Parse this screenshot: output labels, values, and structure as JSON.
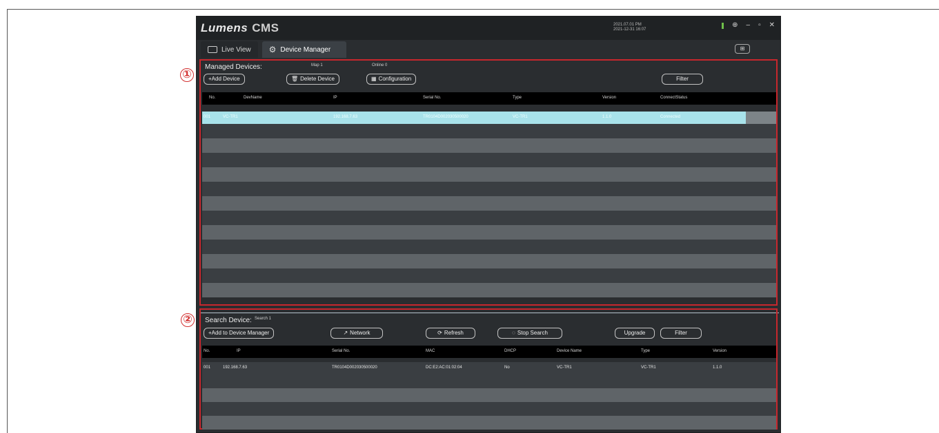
{
  "app": {
    "logo": "Lumens",
    "product": "CMS",
    "datetime_line1": "2021.07.01 PM",
    "datetime_line2": "2021-12-31 16:07",
    "ctrl_minimize": "–",
    "ctrl_maximize": "▫",
    "ctrl_close": "✕",
    "ctrl_pin": "⊕"
  },
  "tabs": [
    {
      "label": "Live View",
      "icon": "live-view-icon"
    },
    {
      "label": "Device Manager",
      "icon": "gear-icon"
    }
  ],
  "lock_label": "⊞",
  "markers": [
    "①",
    "②"
  ],
  "managed": {
    "title": "Managed Devices:",
    "stat_total": "Map 1",
    "stat_online": "Online 0",
    "buttons": {
      "add": "+Add Device",
      "delete": "Delete Device",
      "config": "Configuration",
      "filter": "Filter"
    },
    "columns": [
      "No.",
      "DevName",
      "IP",
      "Serial No.",
      "Type",
      "Version",
      "ConnectStatus"
    ],
    "rows": [
      [
        "001",
        "VC-TR1",
        "192.168.7.63",
        "TR0104D002030500020",
        "VC-TR1",
        "1.1.0",
        "Connected"
      ]
    ]
  },
  "search": {
    "title": "Search Device:",
    "stat": "Search 1",
    "buttons": {
      "add_to_manager": "+Add to Device Manager",
      "network": "Network",
      "refresh": "Refresh",
      "stop": "Stop Search",
      "upgrade": "Upgrade",
      "filter": "Filter"
    },
    "columns": [
      "No.",
      "IP",
      "Serial No.",
      "MAC",
      "DHCP",
      "Device Name",
      "Type",
      "Version"
    ],
    "rows": [
      [
        "001",
        "192.168.7.63",
        "TR0104D002030500020",
        "DC:E2:AC:01:02:04",
        "No",
        "VC-TR1",
        "VC-TR1",
        "1.1.0"
      ]
    ]
  }
}
